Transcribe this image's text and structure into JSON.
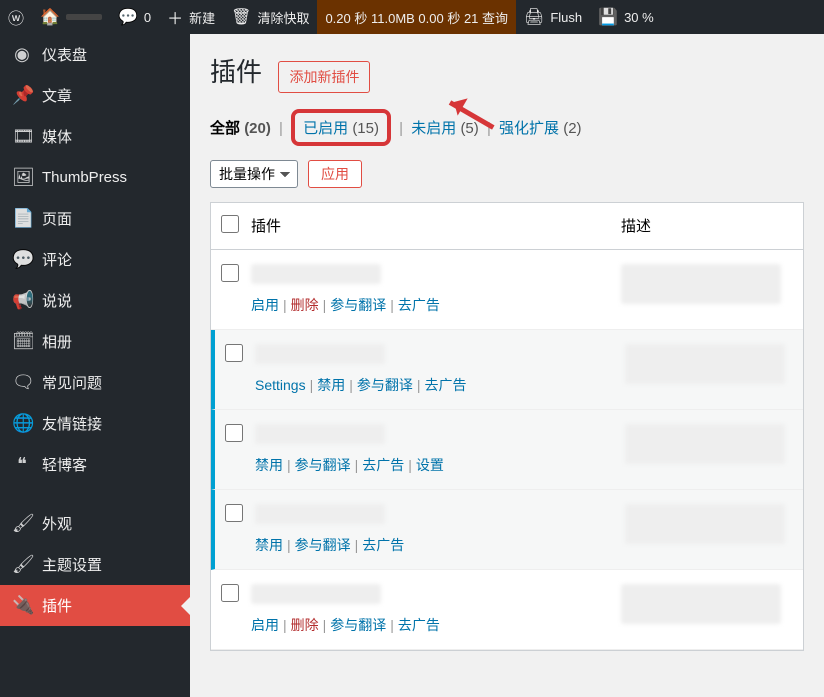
{
  "adminbar": {
    "comments_count": "0",
    "new_label": "新建",
    "clear_cache": "清除快取",
    "timing": "0.20 秒 11.0MB 0.00 秒 21 查询",
    "flush": "Flush",
    "cpu": "30 %"
  },
  "sidebar": {
    "items": [
      {
        "label": "仪表盘",
        "icon": "◉"
      },
      {
        "label": "文章",
        "icon": "📌"
      },
      {
        "label": "媒体",
        "icon": "🎞"
      },
      {
        "label": "ThumbPress",
        "icon": "🖼"
      },
      {
        "label": "页面",
        "icon": "📄"
      },
      {
        "label": "评论",
        "icon": "💬"
      },
      {
        "label": "说说",
        "icon": "📢"
      },
      {
        "label": "相册",
        "icon": "🗓"
      },
      {
        "label": "常见问题",
        "icon": "🗨"
      },
      {
        "label": "友情链接",
        "icon": "🌐"
      },
      {
        "label": "轻博客",
        "icon": "❝"
      },
      {
        "label": "外观",
        "icon": "🖌"
      },
      {
        "label": "主题设置",
        "icon": "🖌"
      },
      {
        "label": "插件",
        "icon": "🔌"
      }
    ]
  },
  "page": {
    "title": "插件",
    "add_new": "添加新插件"
  },
  "filters": {
    "all_label": "全部",
    "all_count": "(20)",
    "active_label": "已启用",
    "active_count": "(15)",
    "inactive_label": "未启用",
    "inactive_count": "(5)",
    "enhance_label": "强化扩展",
    "enhance_count": "(2)"
  },
  "bulk": {
    "select_label": "批量操作",
    "apply": "应用"
  },
  "table": {
    "header_plugin": "插件",
    "header_desc": "描述",
    "rows": [
      {
        "active": false,
        "actions": [
          "启用",
          "删除",
          "参与翻译",
          "去广告"
        ]
      },
      {
        "active": true,
        "actions": [
          "Settings",
          "禁用",
          "参与翻译",
          "去广告"
        ]
      },
      {
        "active": true,
        "actions": [
          "禁用",
          "参与翻译",
          "去广告",
          "设置"
        ]
      },
      {
        "active": true,
        "actions": [
          "禁用",
          "参与翻译",
          "去广告"
        ]
      },
      {
        "active": false,
        "actions": [
          "启用",
          "删除",
          "参与翻译",
          "去广告"
        ]
      }
    ]
  }
}
